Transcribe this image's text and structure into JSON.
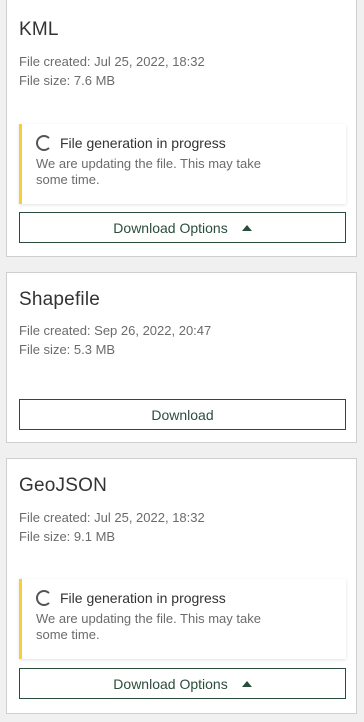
{
  "cards": [
    {
      "title": "KML",
      "created": "File created: Jul 25, 2022, 18:32",
      "size": "File size: 7.6 MB",
      "notice": {
        "title": "File generation in progress",
        "body": "We are updating the file. This may take some time."
      },
      "button": {
        "label": "Download Options",
        "icon": "caret-up-icon"
      }
    },
    {
      "title": "Shapefile",
      "created": "File created: Sep 26, 2022, 20:47",
      "size": "File size: 5.3 MB",
      "button": {
        "label": "Download"
      }
    },
    {
      "title": "GeoJSON",
      "created": "File created: Jul 25, 2022, 18:32",
      "size": "File size: 9.1 MB",
      "notice": {
        "title": "File generation in progress",
        "body": "We are updating the file. This may take some time."
      },
      "button": {
        "label": "Download Options",
        "icon": "caret-up-icon"
      }
    }
  ],
  "colors": {
    "accent": "#2a4d3c",
    "notice_bar": "#f2cf3b",
    "border": "#cfcfcf",
    "background": "#f0f0f0"
  }
}
